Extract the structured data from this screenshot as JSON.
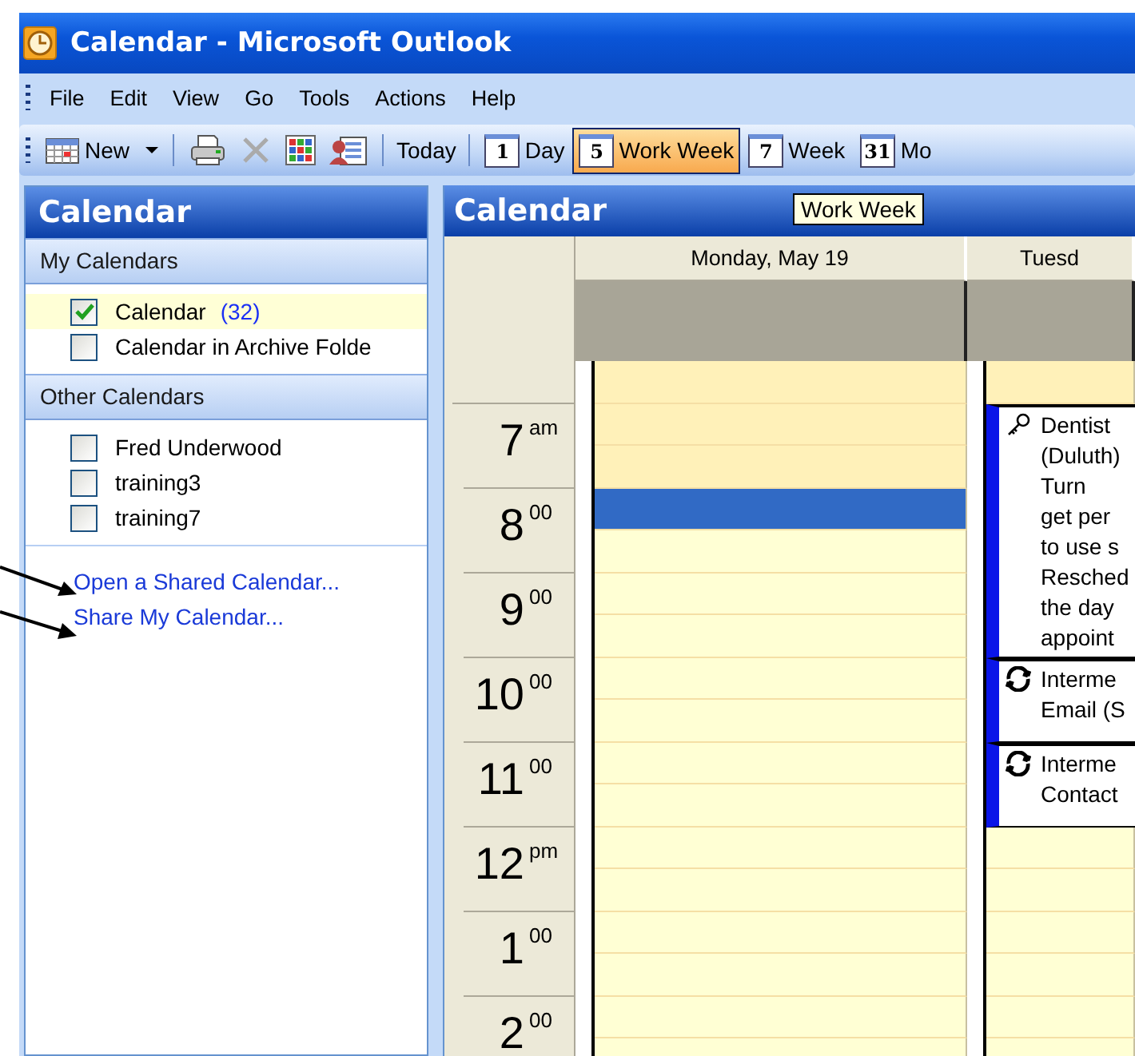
{
  "window": {
    "title": "Calendar - Microsoft Outlook"
  },
  "menu": [
    "File",
    "Edit",
    "View",
    "Go",
    "Tools",
    "Actions",
    "Help"
  ],
  "toolbar": [
    {
      "kind": "new",
      "label": "New"
    },
    {
      "kind": "separator"
    },
    {
      "kind": "print"
    },
    {
      "kind": "delete"
    },
    {
      "kind": "grid"
    },
    {
      "kind": "address"
    },
    {
      "kind": "separator"
    },
    {
      "kind": "text",
      "label": "Today"
    },
    {
      "kind": "separator"
    }
  ],
  "view_buttons": [
    {
      "badge": "1",
      "label": "Day",
      "selected": false
    },
    {
      "badge": "5",
      "label": "Work Week",
      "selected": true
    },
    {
      "badge": "7",
      "label": "Week",
      "selected": false
    },
    {
      "badge": "31",
      "label": "Mo",
      "selected": false
    }
  ],
  "navigation": {
    "title": "Calendar",
    "sections": [
      {
        "title": "My Calendars",
        "items": [
          {
            "label": "Calendar",
            "count": "(32)",
            "checked": true,
            "selected": true
          },
          {
            "label": "Calendar in Archive Folde",
            "checked": false,
            "selected": false
          }
        ]
      },
      {
        "title": "Other Calendars",
        "items": [
          {
            "label": "Fred Underwood",
            "checked": false,
            "selected": false
          },
          {
            "label": "training3",
            "checked": false,
            "selected": false
          },
          {
            "label": "training7",
            "checked": false,
            "selected": false
          }
        ]
      }
    ],
    "links": [
      "Open a Shared Calendar...",
      "Share My Calendar..."
    ]
  },
  "calendar": {
    "title": "Calendar",
    "tooltip": "Work Week",
    "hours": [
      {
        "hour": "7",
        "suffix": "am"
      },
      {
        "hour": "8",
        "suffix": "00"
      },
      {
        "hour": "9",
        "suffix": "00"
      },
      {
        "hour": "10",
        "suffix": "00"
      },
      {
        "hour": "11",
        "suffix": "00"
      },
      {
        "hour": "12",
        "suffix": "pm"
      },
      {
        "hour": "1",
        "suffix": "00"
      },
      {
        "hour": "2",
        "suffix": "00"
      }
    ],
    "days": [
      {
        "heading": "Monday, May 19",
        "items": [
          {
            "kind": "slot",
            "working": false,
            "selected": false
          },
          {
            "kind": "slot",
            "working": false,
            "selected": false
          },
          {
            "kind": "slot",
            "working": false,
            "selected": false
          },
          {
            "kind": "slot",
            "working": true,
            "selected": true
          },
          {
            "kind": "slot",
            "working": true,
            "selected": false
          },
          {
            "kind": "slot",
            "working": true,
            "selected": false
          },
          {
            "kind": "slot",
            "working": true,
            "selected": false
          },
          {
            "kind": "slot",
            "working": true,
            "selected": false
          },
          {
            "kind": "slot",
            "working": true,
            "selected": false
          },
          {
            "kind": "slot",
            "working": true,
            "selected": false
          },
          {
            "kind": "slot",
            "working": true,
            "selected": false
          },
          {
            "kind": "slot",
            "working": true,
            "selected": false
          },
          {
            "kind": "slot",
            "working": true,
            "selected": false
          },
          {
            "kind": "slot",
            "working": true,
            "selected": false
          },
          {
            "kind": "slot",
            "working": true,
            "selected": false
          },
          {
            "kind": "slot",
            "working": true,
            "selected": false
          },
          {
            "kind": "slot",
            "working": true,
            "selected": false
          }
        ]
      },
      {
        "heading": "Tuesd",
        "items": [
          {
            "kind": "slot",
            "working": false,
            "selected": false
          },
          {
            "kind": "keyed_appointment",
            "lines": [
              "Dentist",
              "(Duluth)",
              "Turn",
              "get per",
              "to use s",
              "Resched",
              "the day",
              "appoint"
            ]
          },
          {
            "kind": "recurring_appointment",
            "lines": [
              "Interme",
              "Email (S"
            ]
          },
          {
            "kind": "recurring_appointment",
            "lines": [
              "Interme",
              "Contact"
            ]
          },
          {
            "kind": "slot",
            "working": true,
            "selected": false
          },
          {
            "kind": "slot",
            "working": true,
            "selected": false
          },
          {
            "kind": "slot",
            "working": true,
            "selected": false
          },
          {
            "kind": "slot",
            "working": true,
            "selected": false
          },
          {
            "kind": "slot",
            "working": true,
            "selected": false
          },
          {
            "kind": "slot",
            "working": true,
            "selected": false
          }
        ]
      }
    ]
  }
}
